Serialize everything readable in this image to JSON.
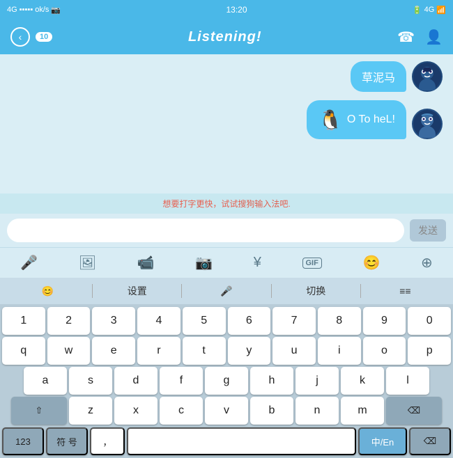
{
  "statusBar": {
    "signal": "4G",
    "signalBars": "4G ▪▪▪▪",
    "network": "ok/s",
    "time": "13:20",
    "batteryLabel": "4G",
    "icons": "battery"
  },
  "header": {
    "backLabel": "‹",
    "badgeCount": "10",
    "title": "Listening!",
    "callIcon": "📞",
    "profileIcon": "👤"
  },
  "messages": [
    {
      "text": "草泥马",
      "type": "sent",
      "avatar": "avatar1"
    },
    {
      "sticker": "🐧",
      "text": "O To heL!",
      "type": "sent",
      "avatar": "avatar2"
    }
  ],
  "inputHint": {
    "prefix": "想要打字更快，试试",
    "highlight": "搜狗输入法",
    "suffix": "吧."
  },
  "inputBar": {
    "placeholder": "",
    "sendLabel": "发送"
  },
  "toolbar": {
    "items": [
      "mic",
      "image",
      "video",
      "camera",
      "yen",
      "gif",
      "emoji",
      "plus"
    ]
  },
  "kbTopRow": {
    "items": [
      "😊",
      "设置",
      "🎤",
      "切换",
      "≡≡≡"
    ]
  },
  "keyboard": {
    "row1": [
      "1",
      "2",
      "3",
      "4",
      "5",
      "6",
      "7",
      "8",
      "9",
      "0"
    ],
    "row2": [
      "q",
      "w",
      "e",
      "r",
      "t",
      "y",
      "u",
      "i",
      "o",
      "p"
    ],
    "row3": [
      "a",
      "s",
      "d",
      "f",
      "g",
      "h",
      "j",
      "k",
      "l"
    ],
    "row4": [
      "z",
      "x",
      "c",
      "v",
      "b",
      "n",
      "m"
    ],
    "bottomRow": {
      "sym": "123",
      "sym2": "符 号",
      "comma": "，",
      "space": "",
      "chinese": "中/En",
      "delete": "⌫"
    }
  }
}
